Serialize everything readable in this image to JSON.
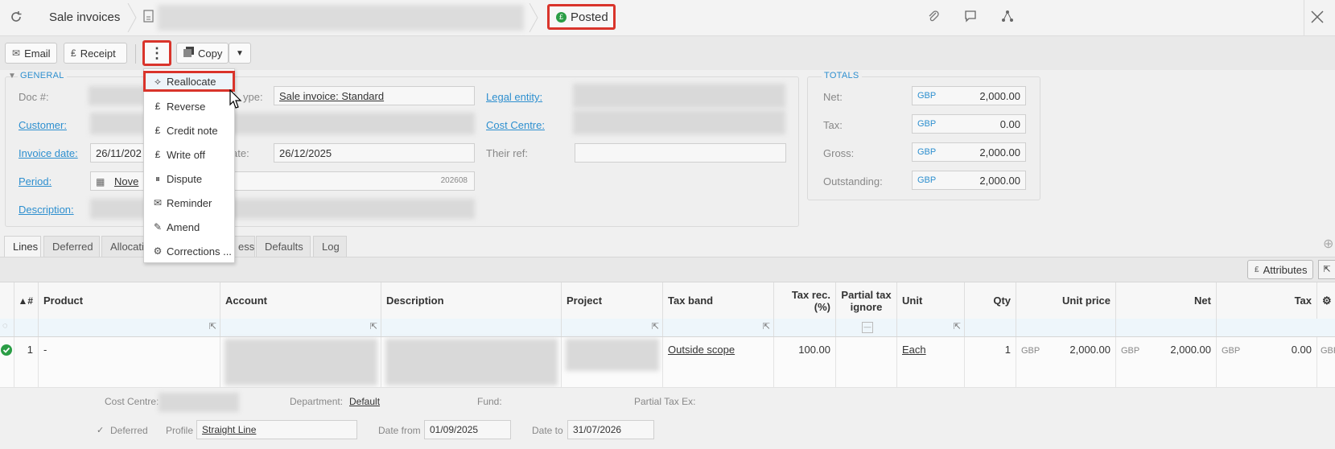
{
  "topbar": {
    "app_title": "Sale invoices",
    "status": "Posted",
    "status_icon_glyph": "£",
    "icons": [
      "refresh-icon",
      "document-icon",
      "paperclip-icon",
      "comment-icon",
      "share-icon",
      "close-icon"
    ]
  },
  "toolbar": {
    "email_label": "Email",
    "receipt_label": "Receipt",
    "more_glyph": "⋮",
    "copy_label": "Copy",
    "copy_caret": "▼"
  },
  "menu": {
    "items": [
      {
        "label": "Reallocate",
        "icon": "share-icon",
        "glyph": "⟡"
      },
      {
        "label": "Reverse",
        "icon": "pound-undo-icon",
        "glyph": "₤"
      },
      {
        "label": "Credit note",
        "icon": "pound-undo-icon",
        "glyph": "₤"
      },
      {
        "label": "Write off",
        "icon": "pound-undo-icon",
        "glyph": "₤"
      },
      {
        "label": "Dispute",
        "icon": "pause-icon",
        "glyph": "⏸"
      },
      {
        "label": "Reminder",
        "icon": "envelope-icon",
        "glyph": "✉"
      },
      {
        "label": "Amend",
        "icon": "pencil-icon",
        "glyph": "✎"
      },
      {
        "label": "Corrections ...",
        "icon": "gear-icon",
        "glyph": "⚙"
      }
    ]
  },
  "general": {
    "legend": "GENERAL",
    "doc_label": "Doc #:",
    "type_label": "ype:",
    "type_value": "Sale invoice: Standard",
    "legal_entity_label": "Legal entity:",
    "customer_label": "Customer:",
    "cost_centre_label": "Cost Centre:",
    "invoice_date_label": "Invoice date:",
    "invoice_date_value": "26/11/202",
    "due_date_label": "ate:",
    "due_date_value": "26/12/2025",
    "their_ref_label": "Their ref:",
    "period_label": "Period:",
    "period_value": "Nove",
    "period_code": "202608",
    "description_label": "Description:"
  },
  "totals": {
    "legend": "TOTALS",
    "rows": [
      {
        "label": "Net:",
        "currency": "GBP",
        "value": "2,000.00"
      },
      {
        "label": "Tax:",
        "currency": "GBP",
        "value": "0.00"
      },
      {
        "label": "Gross:",
        "currency": "GBP",
        "value": "2,000.00"
      },
      {
        "label": "Outstanding:",
        "currency": "GBP",
        "value": "2,000.00"
      }
    ]
  },
  "tabs": {
    "lines": "Lines",
    "deferred": "Deferred",
    "allocations": "Allocati",
    "process": "ess",
    "defaults": "Defaults",
    "log": "Log"
  },
  "grid": {
    "attributes_label": "Attributes",
    "headers": {
      "num": "▲#",
      "product": "Product",
      "account": "Account",
      "description": "Description",
      "project": "Project",
      "tax_band": "Tax band",
      "tax_rec": "Tax rec. (%)",
      "partial_tax": "Partial tax ignore",
      "unit": "Unit",
      "qty": "Qty",
      "unit_price": "Unit price",
      "net": "Net",
      "tax": "Tax"
    },
    "row": {
      "num": "1",
      "product": "-",
      "tax_band": "Outside scope",
      "tax_rec": "100.00",
      "unit": "Each",
      "qty": "1",
      "unit_price_cur": "GBP",
      "unit_price": "2,000.00",
      "net_cur": "GBP",
      "net": "2,000.00",
      "tax_cur": "GBP",
      "tax": "0.00",
      "overflow_cur": "GBF"
    }
  },
  "detail": {
    "cost_centre_label": "Cost Centre:",
    "department_label": "Department:",
    "department_value": "Default",
    "fund_label": "Fund:",
    "partial_tax_ex_label": "Partial Tax Ex:",
    "deferred_label": "Deferred",
    "profile_label": "Profile",
    "profile_value": "Straight Line",
    "date_from_label": "Date from",
    "date_from_value": "01/09/2025",
    "date_to_label": "Date to",
    "date_to_value": "31/07/2026"
  }
}
